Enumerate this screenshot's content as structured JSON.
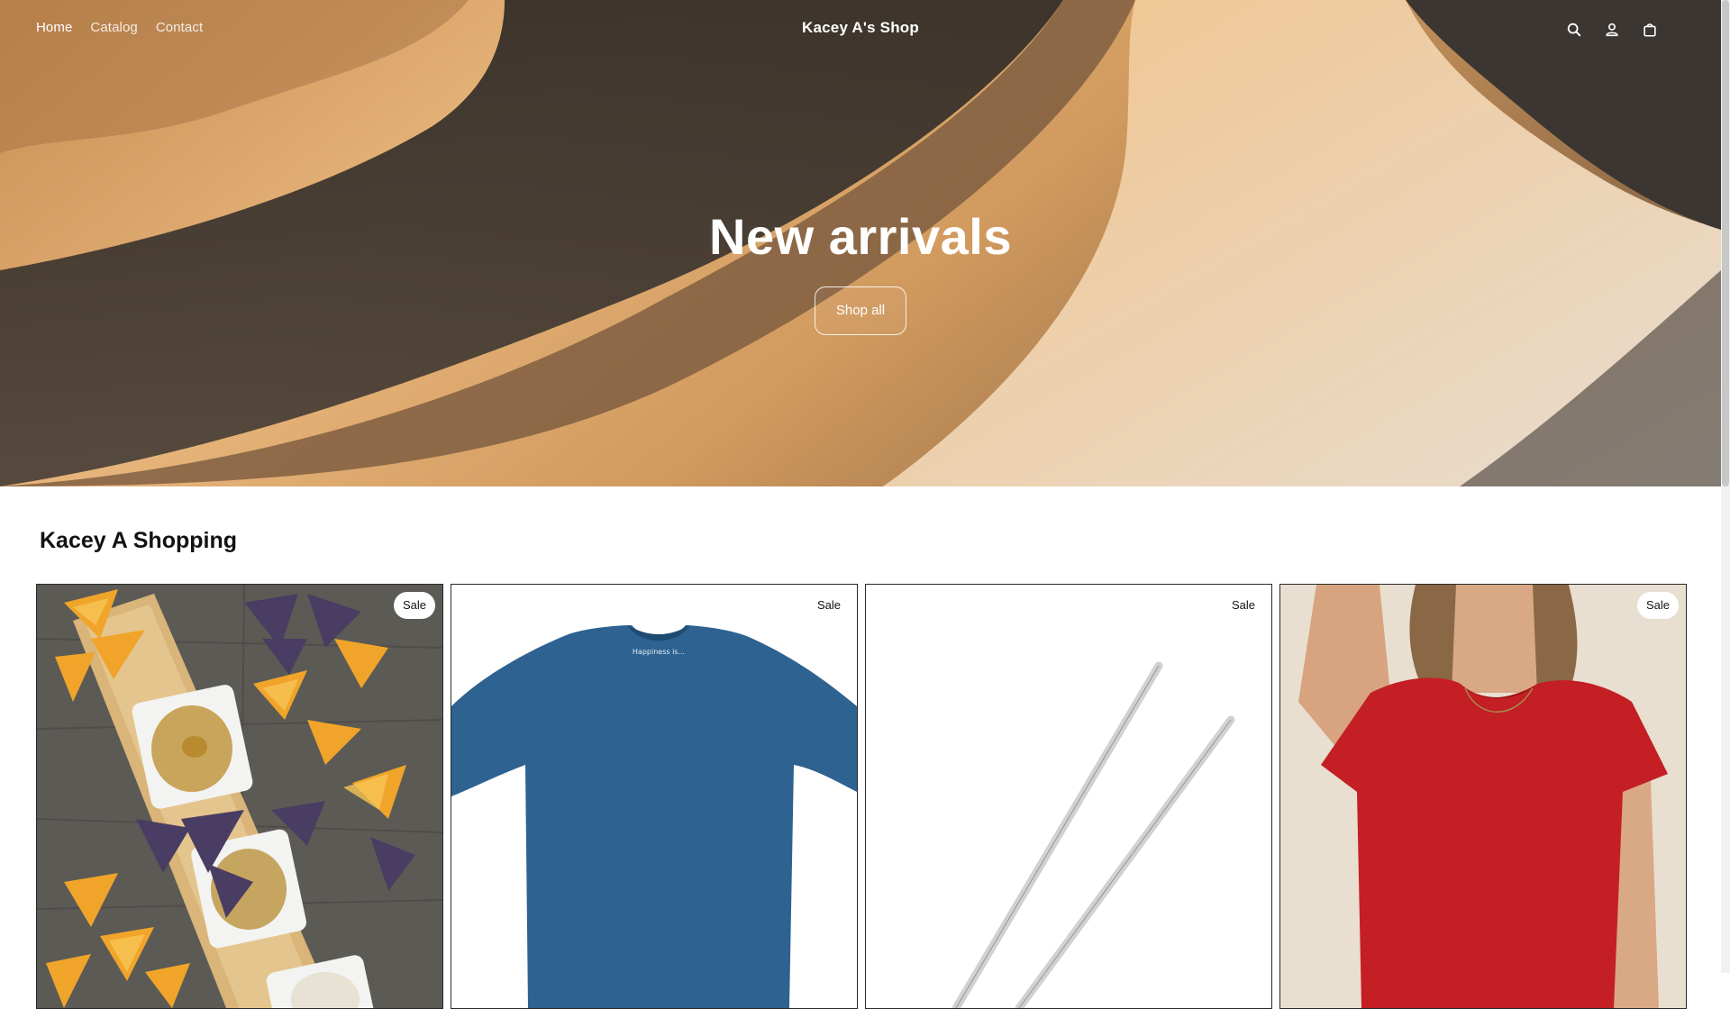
{
  "header": {
    "brand": "Kacey A's Shop",
    "nav": [
      {
        "label": "Home",
        "active": true
      },
      {
        "label": "Catalog",
        "active": false
      },
      {
        "label": "Contact",
        "active": false
      }
    ],
    "icons": [
      "search-icon",
      "account-icon",
      "cart-icon"
    ]
  },
  "hero": {
    "title": "New arrivals",
    "button_label": "Shop all"
  },
  "collection": {
    "title": "Kacey A Shopping",
    "products": [
      {
        "badge": "Sale",
        "image": "chips-and-hummus-platter"
      },
      {
        "badge": "Sale",
        "image": "blue-t-shirt",
        "shirt_print": "Happiness is..."
      },
      {
        "badge": "Sale",
        "image": "metal-chopsticks"
      },
      {
        "badge": "Sale",
        "image": "red-t-shirt-model"
      }
    ]
  },
  "colors": {
    "text": "#121212",
    "hero_sand": "#d9a267",
    "hero_shadow": "#3a342f",
    "shirt_blue": "#2d6291",
    "shirt_red": "#c41f24"
  }
}
